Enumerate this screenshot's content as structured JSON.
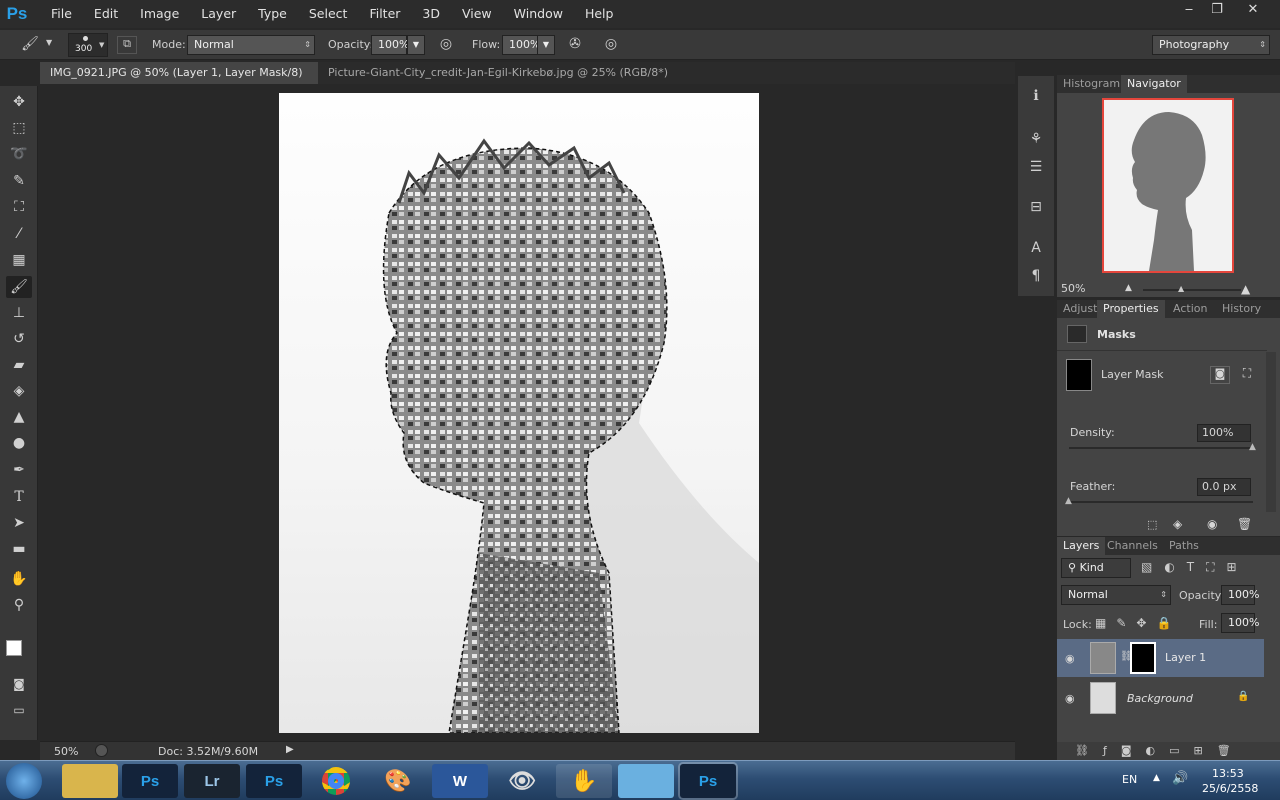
{
  "app": {
    "logo": "Ps"
  },
  "menu": [
    "File",
    "Edit",
    "Image",
    "Layer",
    "Type",
    "Select",
    "Filter",
    "3D",
    "View",
    "Window",
    "Help"
  ],
  "options": {
    "brush_size": "300",
    "mode_label": "Mode:",
    "mode_value": "Normal",
    "opacity_label": "Opacity:",
    "opacity_value": "100%",
    "flow_label": "Flow:",
    "flow_value": "100%",
    "workspace": "Photography"
  },
  "tabs": [
    {
      "label": "IMG_0921.JPG @ 50% (Layer 1, Layer Mask/8) *"
    },
    {
      "label": "Picture-Giant-City_credit-Jan-Egil-Kirkebø.jpg @ 25% (RGB/8*) *"
    }
  ],
  "status": {
    "zoom": "50%",
    "doc": "Doc: 3.52M/9.60M"
  },
  "navigator": {
    "tabs": [
      "Histogram",
      "Navigator"
    ],
    "zoom": "50%"
  },
  "properties": {
    "tabs": [
      "Adjust",
      "Properties",
      "Action",
      "History"
    ],
    "title": "Masks",
    "mask_label": "Layer Mask",
    "density_label": "Density:",
    "density_value": "100%",
    "density_level": 1.0,
    "feather_label": "Feather:",
    "feather_value": "0.0 px",
    "feather_level": 0.0
  },
  "layers": {
    "tabs": [
      "Layers",
      "Channels",
      "Paths"
    ],
    "filter": "Kind",
    "blend": "Normal",
    "opacity_label": "Opacity:",
    "opacity_value": "100%",
    "lock_label": "Lock:",
    "fill_label": "Fill:",
    "fill_value": "100%",
    "items": [
      {
        "name": "Layer 1"
      },
      {
        "name": "Background"
      }
    ]
  },
  "taskbar": {
    "lang": "EN",
    "time": "13:53",
    "date": "25/6/2558"
  },
  "colors": {
    "accent": "#2aa0e8",
    "selected_layer": "#5a6b85"
  }
}
